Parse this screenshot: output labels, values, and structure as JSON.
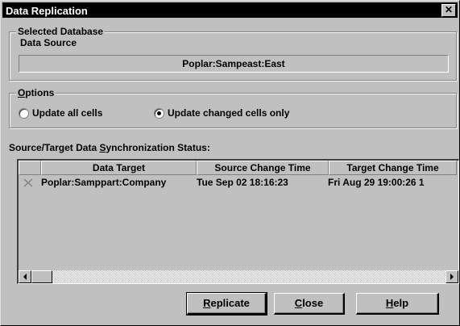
{
  "window": {
    "title": "Data Replication",
    "close_glyph": "✕"
  },
  "selected_database": {
    "group_label": "Selected Database",
    "field_label": "Data Source",
    "value": "Poplar:Sampeast:East"
  },
  "options": {
    "group_label_access": "O",
    "group_label_rest": "ptions",
    "radios": [
      {
        "label": "Update all cells",
        "selected": false
      },
      {
        "label": "Update changed cells only",
        "selected": true
      }
    ]
  },
  "sync_status": {
    "label_pre": "Source/Target Data ",
    "label_access": "S",
    "label_post": "ynchronization Status:",
    "columns": [
      "",
      "Data Target",
      "Source Change Time",
      "Target Change Time"
    ],
    "rows": [
      {
        "icon": "x-mark-icon",
        "data_target": "Poplar:Samppart:Company",
        "source_change_time": "Tue Sep 02 18:16:23",
        "target_change_time": "Fri Aug 29 19:00:26 1"
      }
    ]
  },
  "buttons": {
    "replicate_access": "R",
    "replicate_rest": "eplicate",
    "close_access": "C",
    "close_rest": "lose",
    "help_access": "H",
    "help_rest": "elp"
  }
}
